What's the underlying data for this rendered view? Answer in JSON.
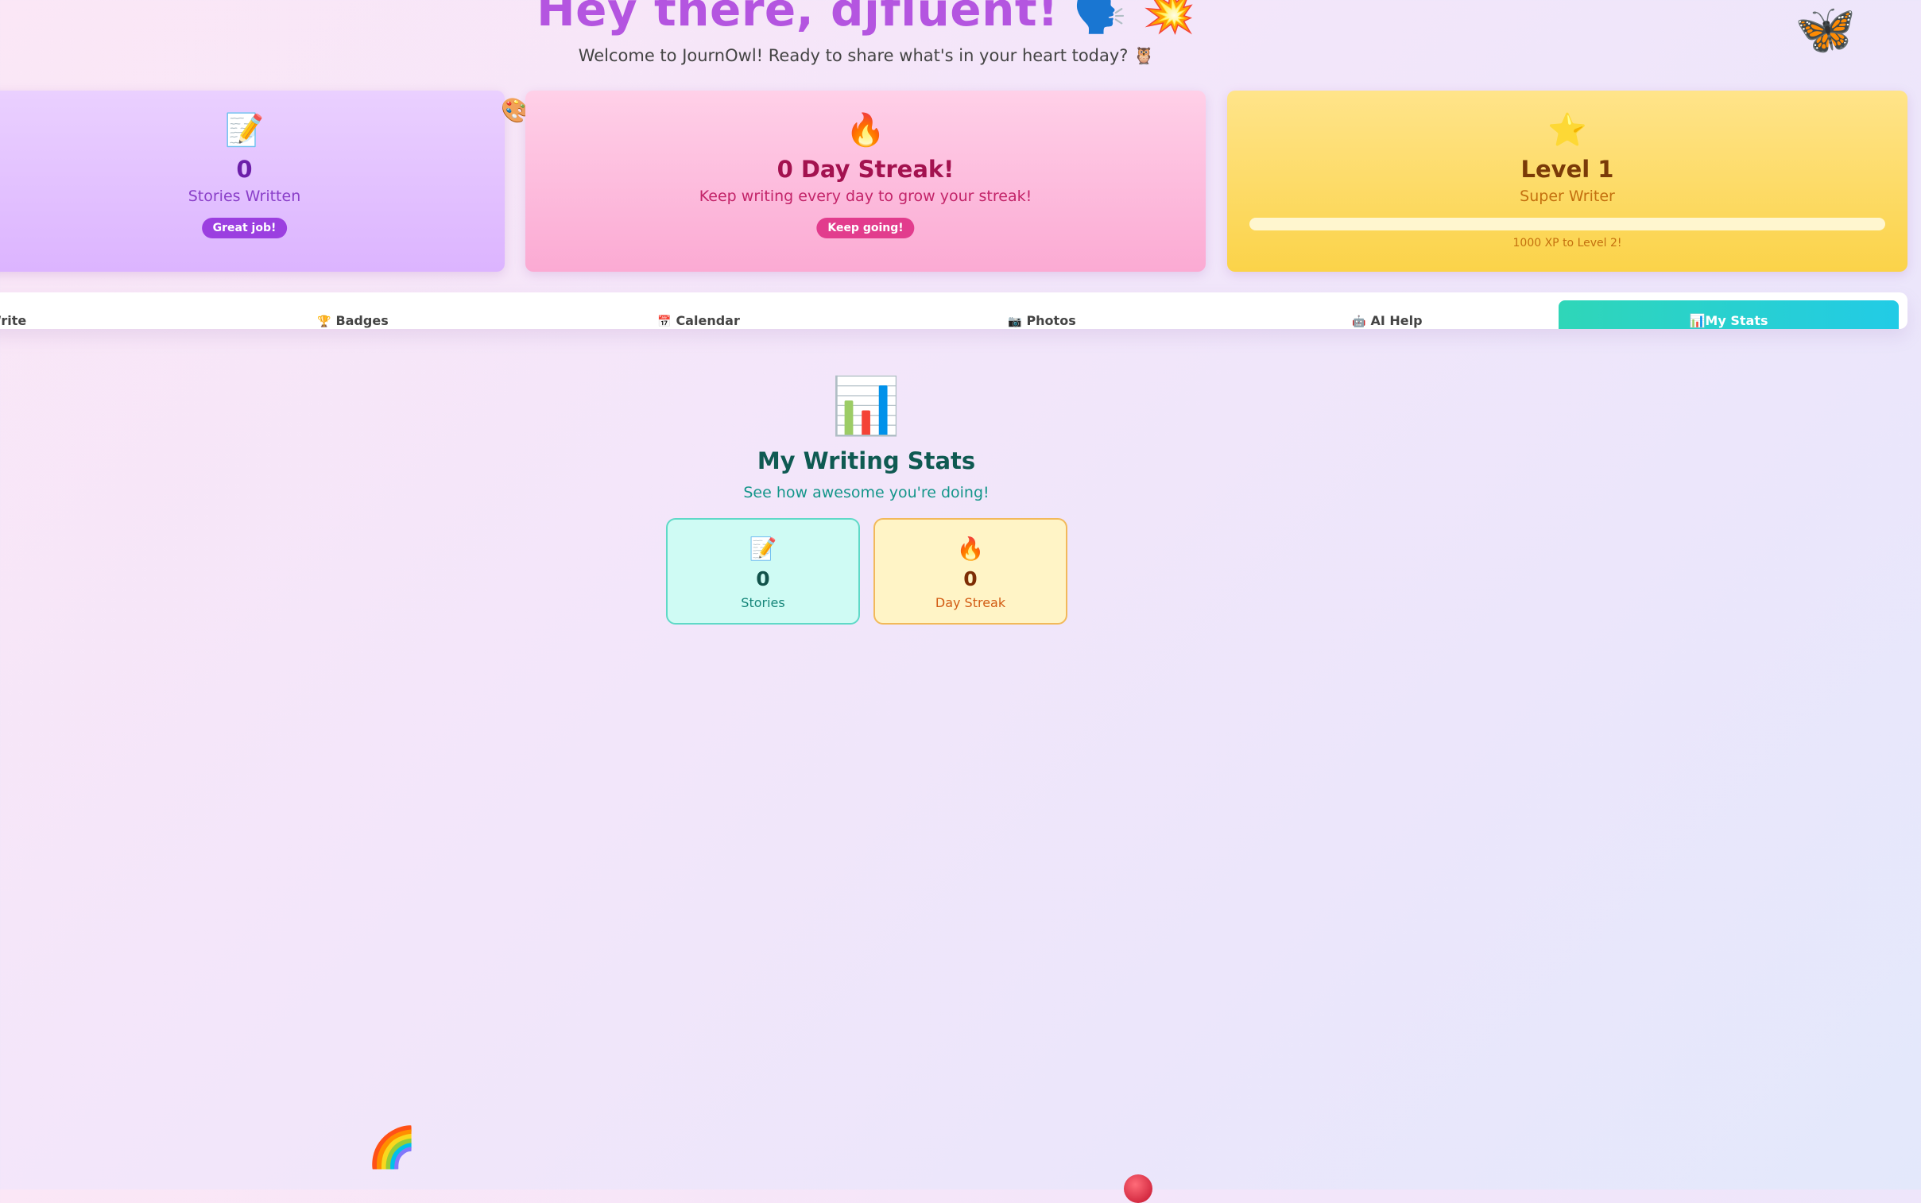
{
  "header": {
    "greeting": "Hey there, djfluent!",
    "greeting_emojis": "🗣️ 💥",
    "subtitle": "Welcome to JournOwl! Ready to share what's in your heart today? 🦉",
    "butterfly_icon": "🦋"
  },
  "cards": {
    "stories": {
      "icon": "📝",
      "value": "0",
      "label": "Stories Written",
      "pill": "Great job!"
    },
    "streak": {
      "icon": "🔥",
      "value": "0 Day Streak!",
      "label": "Keep writing every day to grow your streak!",
      "pill": "Keep going!"
    },
    "level": {
      "icon": "⭐",
      "value": "Level 1",
      "label": "Super Writer",
      "progress_fraction": 0.0,
      "progress_text": "1000 XP to Level 2!"
    },
    "palette_icon": "🎨"
  },
  "tabs": [
    {
      "icon": "",
      "label": "Write"
    },
    {
      "icon": "🏆",
      "label": "Badges"
    },
    {
      "icon": "📅",
      "label": "Calendar"
    },
    {
      "icon": "📷",
      "label": "Photos"
    },
    {
      "icon": "🤖",
      "label": "AI Help"
    },
    {
      "icon": "📊",
      "label": "My Stats"
    }
  ],
  "stats": {
    "icon": "📊",
    "title": "My Writing Stats",
    "subtitle": "See how awesome you're doing!",
    "stories": {
      "icon": "📝",
      "value": "0",
      "label": "Stories"
    },
    "streak": {
      "icon": "🔥",
      "value": "0",
      "label": "Day Streak"
    }
  },
  "decor": {
    "rainbow": "🌈",
    "balloon_color": "#c3122c"
  },
  "colors": {
    "accent_purple": "#b455e0",
    "teal_active": "#2fd6b8"
  }
}
